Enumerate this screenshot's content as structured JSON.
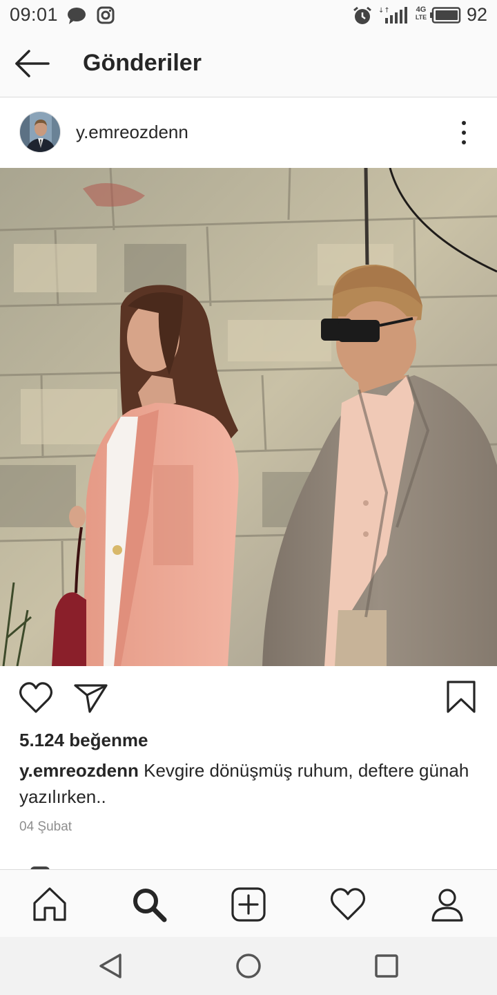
{
  "status_bar": {
    "time": "09:01",
    "left_icons": [
      "chat-bubble-icon",
      "instagram-icon"
    ],
    "right_icons": [
      "alarm-icon",
      "signal-icon",
      "lte-icon",
      "battery-icon"
    ],
    "network": "4G",
    "network_sub": "LTE",
    "battery_percent": "92"
  },
  "header": {
    "title": "Gönderiler",
    "back_icon": "arrow-left-icon"
  },
  "post": {
    "username": "y.emreozdenn",
    "more_icon": "more-vertical-icon",
    "photo_alt_colors": {
      "wall": "#b9b19a",
      "blazer_pink": "#e9a28f",
      "jacket_tweed": "#8e8377"
    },
    "likes": "5.124 beğenme",
    "caption_user": "y.emreozdenn",
    "caption_text": " Kevgire dönüşmüş ruhum, deftere günah yazılırken..",
    "date": "04 Şubat"
  },
  "actions": {
    "like_icon": "heart-icon",
    "share_icon": "paper-plane-icon",
    "save_icon": "bookmark-icon"
  },
  "tabs": [
    {
      "name": "home",
      "icon": "home-icon"
    },
    {
      "name": "search",
      "icon": "search-icon",
      "active": true
    },
    {
      "name": "new-post",
      "icon": "plus-square-icon"
    },
    {
      "name": "activity",
      "icon": "heart-icon"
    },
    {
      "name": "profile",
      "icon": "user-icon"
    }
  ],
  "android_nav": [
    "back-triangle-icon",
    "home-circle-icon",
    "recents-square-icon"
  ],
  "colors": {
    "text": "#262626",
    "secondary": "#8e8e8e",
    "divider": "#dbdbdb",
    "bar_bg": "#fafafa"
  }
}
